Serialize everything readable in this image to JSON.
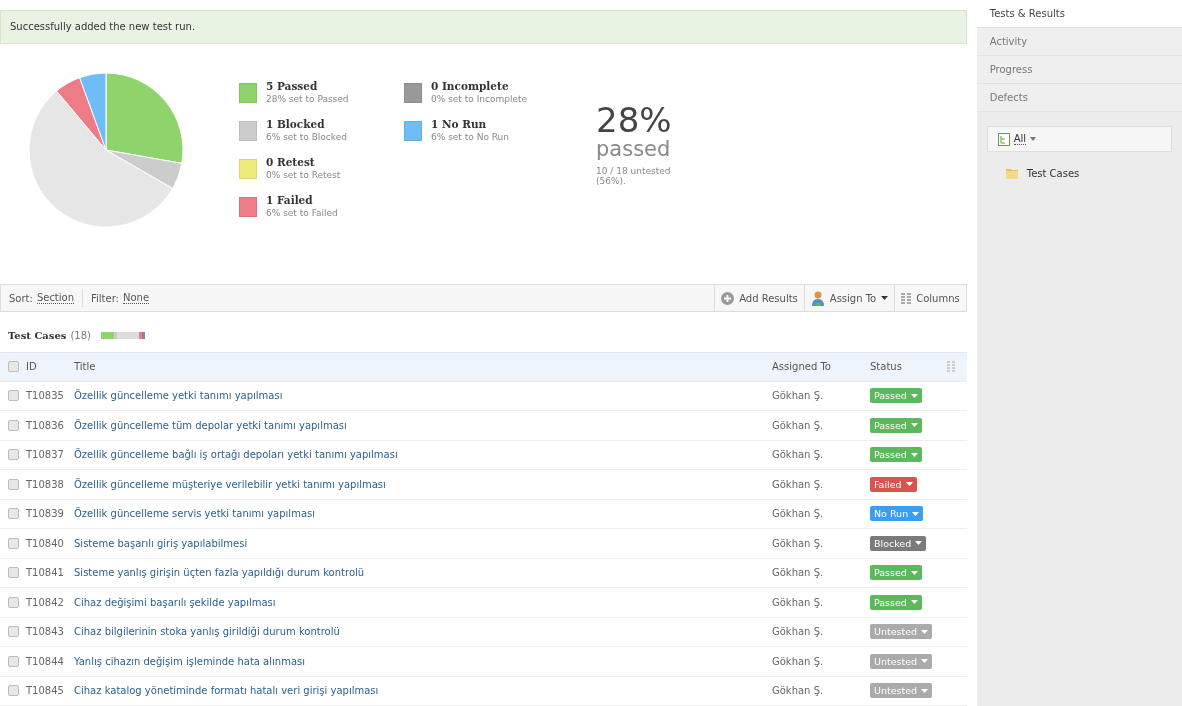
{
  "notice": "Successfully added the new test run.",
  "summary": {
    "legend": [
      {
        "title": "5 Passed",
        "sub": "28% set to Passed",
        "color": "#8fd46b"
      },
      {
        "title": "1 Blocked",
        "sub": "6% set to Blocked",
        "color": "#cccccc"
      },
      {
        "title": "0 Retest",
        "sub": "0% set to Retest",
        "color": "#eeea7c"
      },
      {
        "title": "1 Failed",
        "sub": "6% set to Failed",
        "color": "#ee7c86"
      },
      {
        "title": "0 Incomplete",
        "sub": "0% set to Incomplete",
        "color": "#999999"
      },
      {
        "title": "1 No Run",
        "sub": "6% set to No Run",
        "color": "#6fbcf7"
      }
    ],
    "percent": "28%",
    "percent_label": "passed",
    "untested": "10 / 18 untested (56%)."
  },
  "toolbar": {
    "sort_label": "Sort:",
    "sort_value": "Section",
    "filter_label": "Filter:",
    "filter_value": "None",
    "buttons": [
      "Add Results",
      "Assign To",
      "Columns"
    ]
  },
  "section": {
    "title": "Test Cases",
    "count": "(18)"
  },
  "table": {
    "select_all": {
      "checked": false
    },
    "columns": [
      "ID",
      "Title",
      "Assigned To",
      "Status"
    ],
    "rows": [
      {
        "id": "T10835",
        "title": "Özellik güncelleme yetki tanımı yapılması",
        "assigned": "Gökhan Ş.",
        "status": "Passed",
        "color": "#5cb85c",
        "checked": false
      },
      {
        "id": "T10836",
        "title": "Özellik güncelleme tüm depolar yetki tanımı yapılması",
        "assigned": "Gökhan Ş.",
        "status": "Passed",
        "color": "#5cb85c",
        "checked": false
      },
      {
        "id": "T10837",
        "title": "Özellik güncelleme bağlı iş ortağı depoları yetki tanımı yapılması",
        "assigned": "Gökhan Ş.",
        "status": "Passed",
        "color": "#5cb85c",
        "checked": false
      },
      {
        "id": "T10838",
        "title": "Özellik güncelleme müşteriye verilebilir yetki tanımı yapılması",
        "assigned": "Gökhan Ş.",
        "status": "Failed",
        "color": "#d9534f",
        "checked": false
      },
      {
        "id": "T10839",
        "title": "Özellik güncelleme servis yetki tanımı yapılması",
        "assigned": "Gökhan Ş.",
        "status": "No Run",
        "color": "#3a9ff0",
        "checked": false
      },
      {
        "id": "T10840",
        "title": "Sisteme başarılı giriş yapılabilmesi",
        "assigned": "Gökhan Ş.",
        "status": "Blocked",
        "color": "#7a7a7a",
        "checked": false
      },
      {
        "id": "T10841",
        "title": "Sisteme yanlış girişin üçten fazla yapıldığı durum kontrolü",
        "assigned": "Gökhan Ş.",
        "status": "Passed",
        "color": "#5cb85c",
        "checked": false
      },
      {
        "id": "T10842",
        "title": "Cihaz değişimi başarılı şekilde yapılması",
        "assigned": "Gökhan Ş.",
        "status": "Passed",
        "color": "#5cb85c",
        "checked": false
      },
      {
        "id": "T10843",
        "title": "Cihaz bilgilerinin stoka yanlış girildiği durum kontrolü",
        "assigned": "Gökhan Ş.",
        "status": "Untested",
        "color": "#aaaaaa",
        "checked": false
      },
      {
        "id": "T10844",
        "title": "Yanlış cihazın değişim işleminde hata alınması",
        "assigned": "Gökhan Ş.",
        "status": "Untested",
        "color": "#aaaaaa",
        "checked": false
      },
      {
        "id": "T10845",
        "title": "Cihaz katalog yönetiminde formatı hatalı veri girişi yapılması",
        "assigned": "Gökhan Ş.",
        "status": "Untested",
        "color": "#aaaaaa",
        "checked": false
      }
    ]
  },
  "sidebar": {
    "tabs": [
      {
        "label": "Tests & Results",
        "selected": true
      },
      {
        "label": "Activity",
        "selected": false
      },
      {
        "label": "Progress",
        "selected": false
      },
      {
        "label": "Defects",
        "selected": false
      }
    ],
    "filter": "All",
    "tree": [
      {
        "label": "Test Cases"
      }
    ]
  }
}
